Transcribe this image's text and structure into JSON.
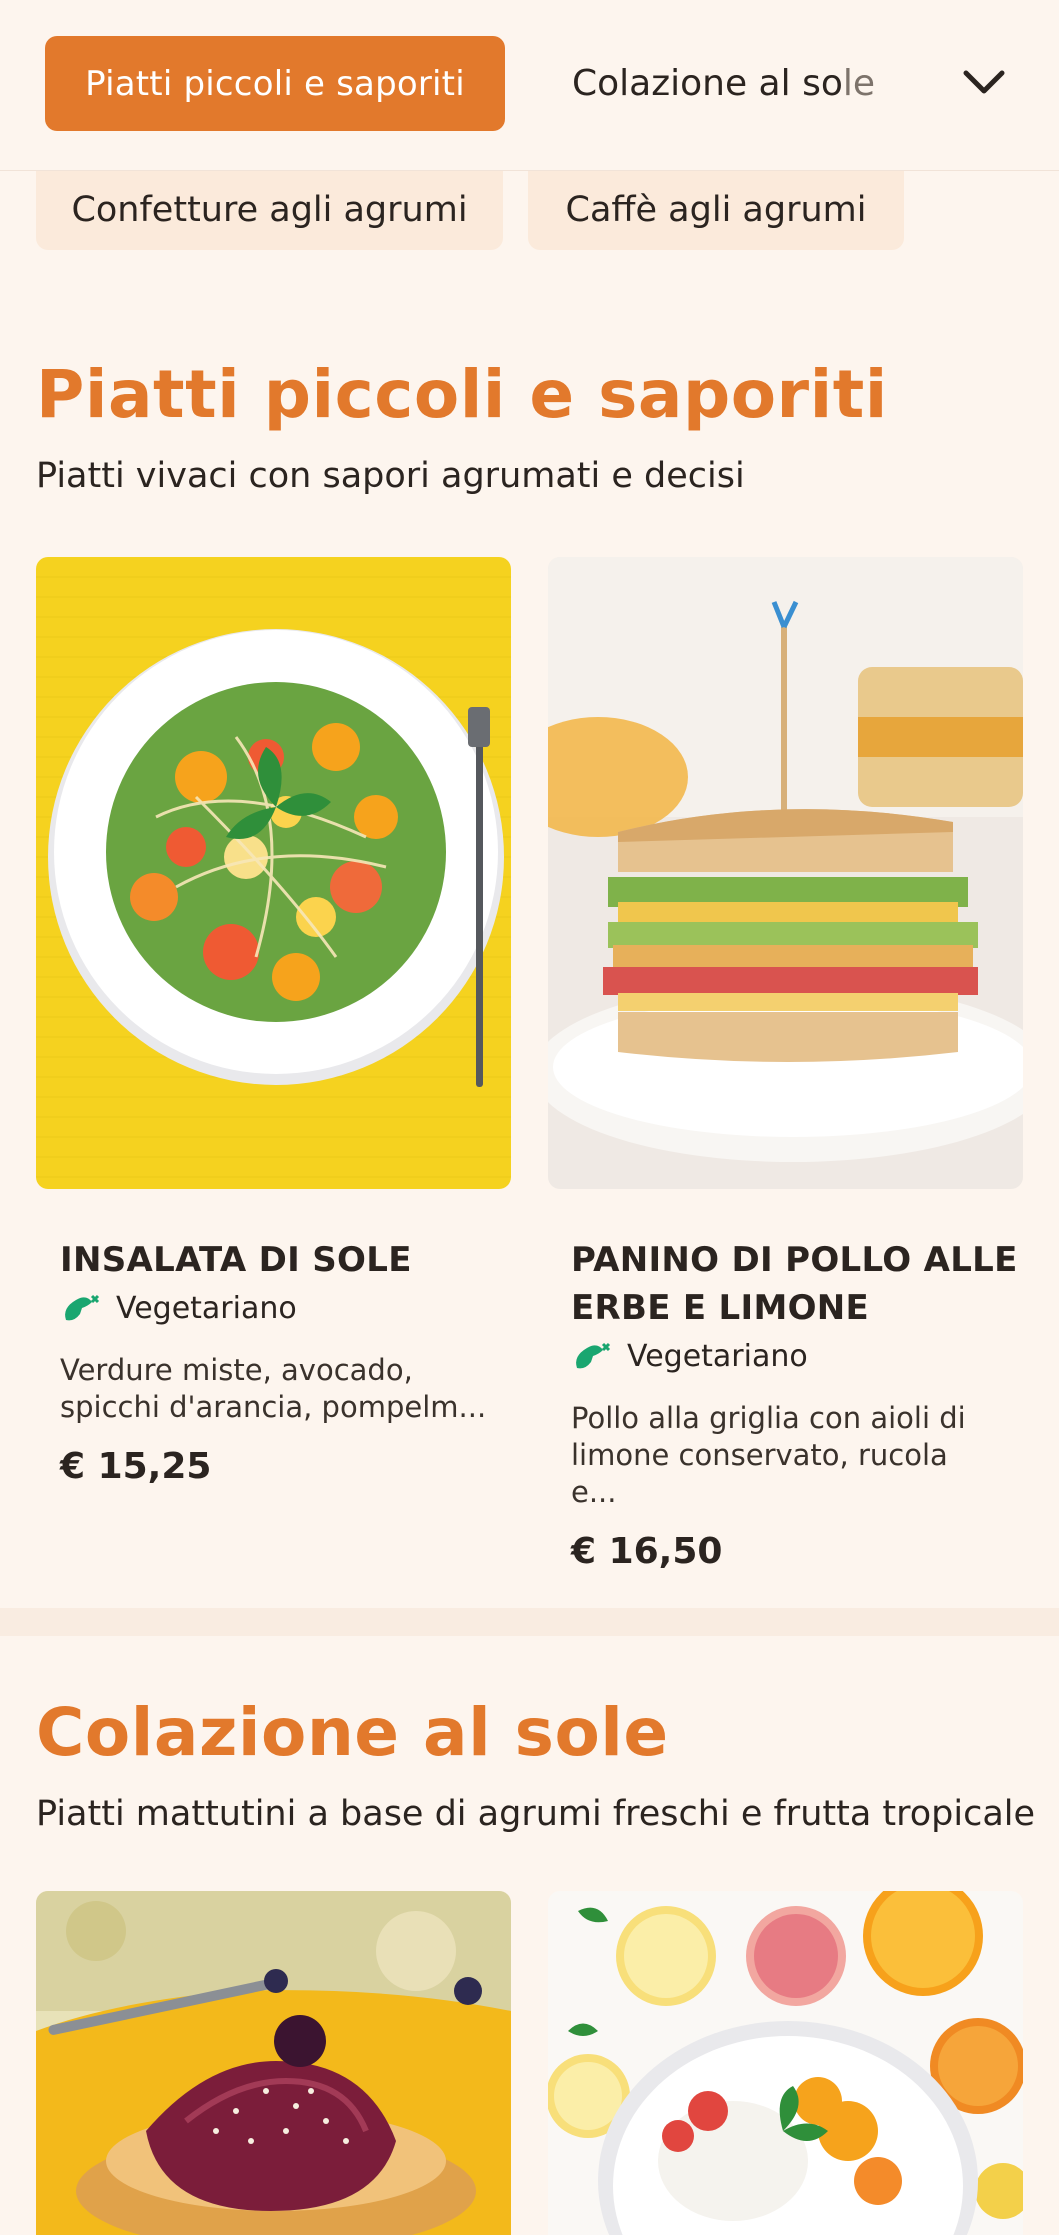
{
  "nav": {
    "active_tab": "Piatti piccoli e saporiti",
    "next_tab_main": "Colazione al so",
    "next_tab_fade": "le",
    "dropdown_icon": "chevron-down-icon"
  },
  "chips": [
    "Confetture agli agrumi",
    "Caffè agli agrumi"
  ],
  "sections": [
    {
      "title": "Piatti piccoli e saporiti",
      "subtitle": "Piatti vivaci con sapori agrumati e decisi",
      "items": [
        {
          "name": "INSALATA DI SOLE",
          "badge": "Vegetariano",
          "description_line1": "Verdure miste, avocado,",
          "description_line2": "spicchi d'arancia, pompelm...",
          "price": "€ 15,25",
          "image": "citrus-salad-photo"
        },
        {
          "name_line1": "PANINO DI POLLO ALLE",
          "name_line2": "ERBE E LIMONE",
          "badge": "Vegetariano",
          "description_line1": "Pollo alla griglia con aioli di",
          "description_line2": "limone conservato, rucola e...",
          "price": "€ 16,50",
          "image": "chicken-sandwich-photo"
        }
      ]
    },
    {
      "title": "Colazione al sole",
      "subtitle": "Piatti mattutini a base di agrumi freschi e frutta tropicale",
      "items": [
        {
          "image": "pancakes-berry-photo"
        },
        {
          "image": "citrus-yogurt-bowl-photo"
        }
      ]
    }
  ],
  "colors": {
    "accent": "#e2792c",
    "background": "#fdf5ee",
    "chip_bg": "#fbeadb",
    "veg_icon": "#1aa670"
  }
}
